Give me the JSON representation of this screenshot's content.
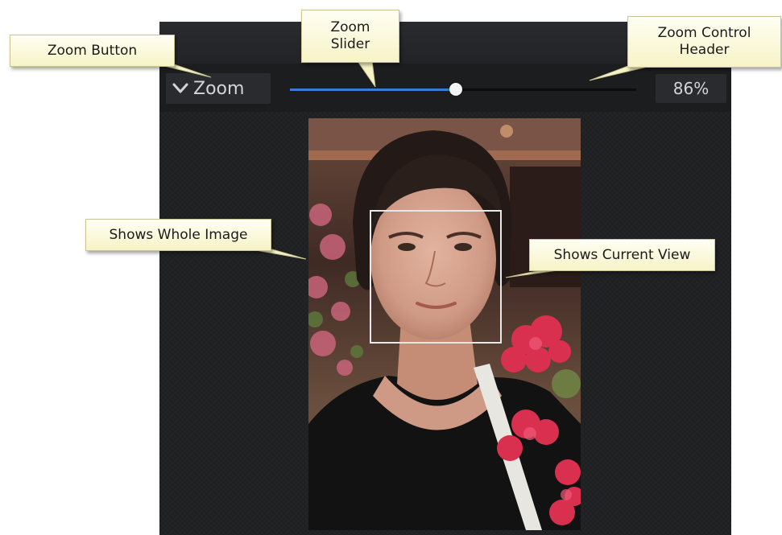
{
  "panel": {
    "zoom_button": {
      "label": "Zoom",
      "icon": "chevron-down-icon"
    },
    "slider": {
      "value_percent": 86,
      "fill_fraction": 0.48
    },
    "zoom_value": "86%",
    "navigator_image": {
      "description_visible": false,
      "view_rect": {
        "shown": true
      }
    }
  },
  "callouts": {
    "zoom_button": "Zoom Button",
    "zoom_slider": "Zoom\nSlider",
    "zoom_control_header": "Zoom Control\nHeader",
    "shows_whole_image": "Shows Whole Image",
    "shows_current_view": "Shows Current View"
  },
  "colors": {
    "slider_fill": "#3a7bd5",
    "callout_bg": "#fbf9d8",
    "panel_bg": "#1f2022"
  }
}
